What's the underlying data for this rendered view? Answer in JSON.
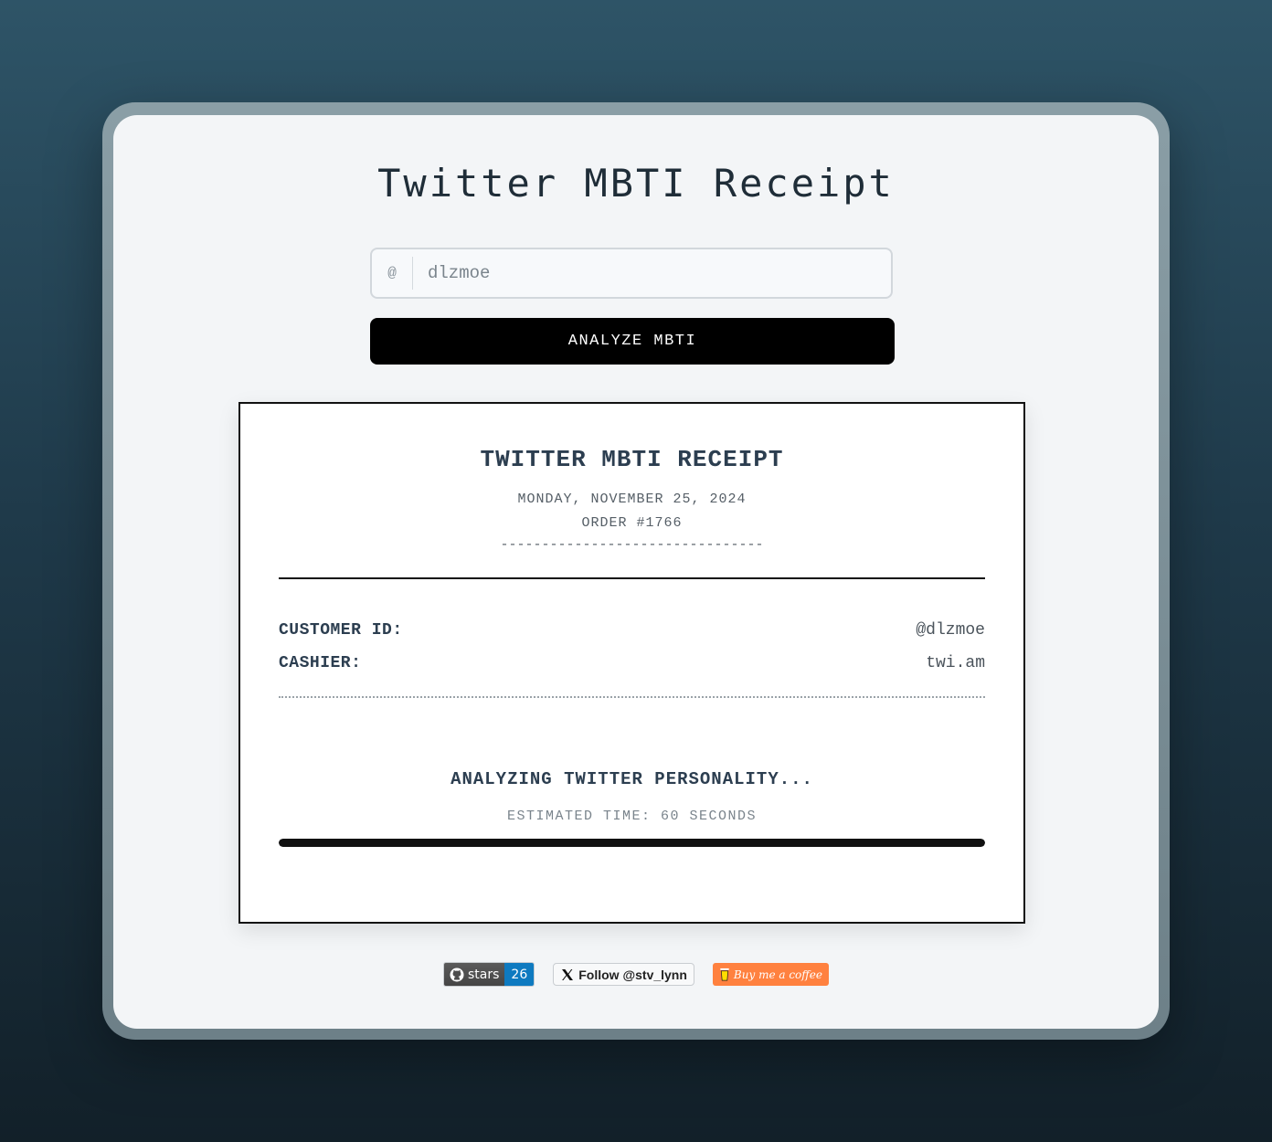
{
  "app": {
    "title": "Twitter MBTI Receipt"
  },
  "form": {
    "prefix": "@",
    "handle_value": "dlzmoe",
    "analyze_label": "ANALYZE MBTI"
  },
  "receipt": {
    "title": "TWITTER MBTI RECEIPT",
    "date": "MONDAY, NOVEMBER 25, 2024",
    "order": "ORDER #1766",
    "dashes": "--------------------------------",
    "customer_label": "CUSTOMER ID:",
    "customer_value": "@dlzmoe",
    "cashier_label": "CASHIER:",
    "cashier_value": "twi.am",
    "analyzing": "ANALYZING TWITTER PERSONALITY...",
    "estimated": "ESTIMATED TIME: 60 SECONDS",
    "progress_fraction": 1.0
  },
  "badges": {
    "github_label": "stars",
    "github_count": "26",
    "x_label": "Follow @stv_lynn",
    "coffee_label": "Buy me a coffee"
  },
  "colors": {
    "accent": "#000000",
    "receipt_text": "#2c3e50",
    "github_count_bg": "#0e7ac0",
    "coffee_bg": "#ff813f"
  }
}
